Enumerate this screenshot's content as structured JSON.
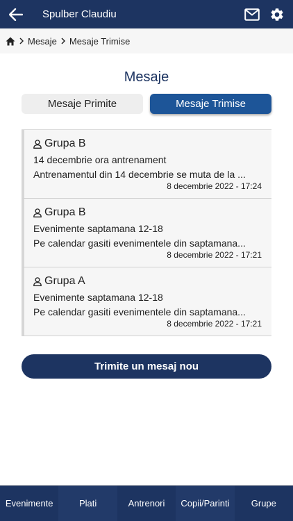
{
  "header": {
    "user_name": "Spulber Claudiu",
    "icons": [
      "arrow-left-icon",
      "mail-icon",
      "gear-icon"
    ]
  },
  "breadcrumb": {
    "items": [
      "Mesaje",
      "Mesaje Trimise"
    ],
    "icons": [
      "home-icon",
      "chevron-right-icon"
    ]
  },
  "page": {
    "title": "Mesaje"
  },
  "tabs": [
    {
      "label": "Mesaje Primite",
      "active": false
    },
    {
      "label": "Mesaje Trimise",
      "active": true
    }
  ],
  "messages": [
    {
      "group": "Grupa B",
      "subject": "14 decembrie ora antrenament",
      "preview": "Antrenamentul din 14 decembrie se muta de la ...",
      "date": "8 decembrie 2022 - 17:24"
    },
    {
      "group": "Grupa B",
      "subject": "Evenimente saptamana 12-18",
      "preview": "Pe calendar gasiti evenimentele din saptamana...",
      "date": "8 decembrie 2022 - 17:21"
    },
    {
      "group": "Grupa A",
      "subject": "Evenimente saptamana 12-18",
      "preview": "Pe calendar gasiti evenimentele din saptamana...",
      "date": "8 decembrie 2022 - 17:21"
    }
  ],
  "actions": {
    "new_message": "Trimite un mesaj nou"
  },
  "nav": [
    "Evenimente",
    "Plati",
    "Antrenori",
    "Copii/Parinti",
    "Grupe"
  ],
  "colors": {
    "primary": "#1d3461",
    "tab_active": "#1d5598",
    "background": "#ffffff",
    "card": "#f6f6f6"
  }
}
